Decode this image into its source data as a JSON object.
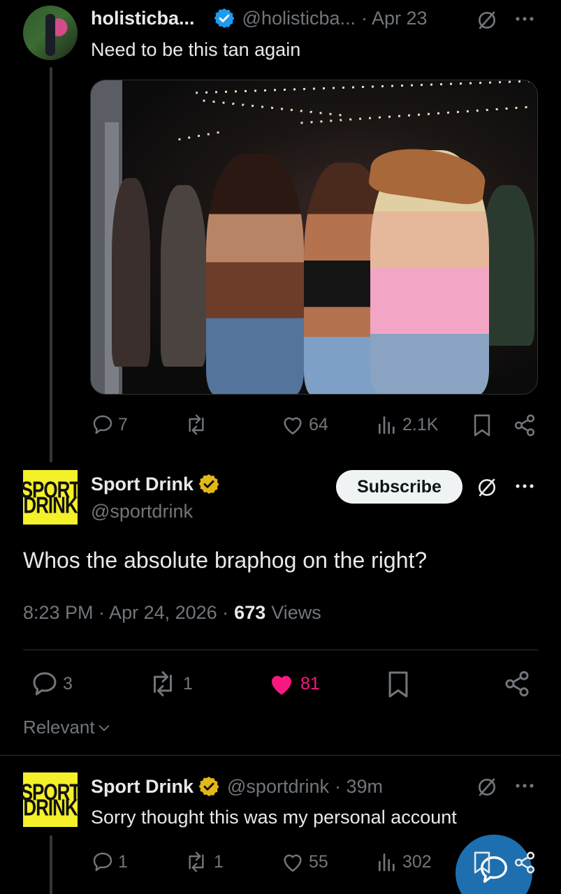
{
  "parent_post": {
    "display_name": "holisticba...",
    "handle": "@holisticba...",
    "date": "· Apr 23",
    "text": "Need to be this tan again",
    "actions": {
      "replies": "7",
      "reposts": "",
      "likes": "64",
      "views": "2.1K"
    }
  },
  "main_post": {
    "display_name": "Sport Drink",
    "handle": "@sportdrink",
    "subscribe_label": "Subscribe",
    "text": "Whos the absolute braphog on the right?",
    "time": "8:23 PM · Apr 24, 2026 ·",
    "views_count": "673",
    "views_label": "Views",
    "actions": {
      "replies": "3",
      "reposts": "1",
      "likes": "81"
    },
    "like_color": "#f91880"
  },
  "sort": {
    "label": "Relevant"
  },
  "reply_post": {
    "display_name": "Sport Drink",
    "handle": "@sportdrink",
    "time": "· 39m",
    "text": "Sorry thought this was my personal account",
    "actions": {
      "replies": "1",
      "reposts": "1",
      "likes": "55",
      "views": "302"
    }
  },
  "logo": {
    "line1": "SPORT",
    "line2": "DRINK"
  },
  "colors": {
    "verified_blue": "#1d9bf0",
    "verified_gold": "#e2b719",
    "logo_yellow": "#f4f02a"
  },
  "icons": [
    "grok-icon",
    "more-icon",
    "reply-icon",
    "repost-icon",
    "like-icon",
    "views-icon",
    "bookmark-icon",
    "share-icon",
    "verified-badge-icon",
    "chevron-down-icon",
    "compose-reply-icon"
  ]
}
